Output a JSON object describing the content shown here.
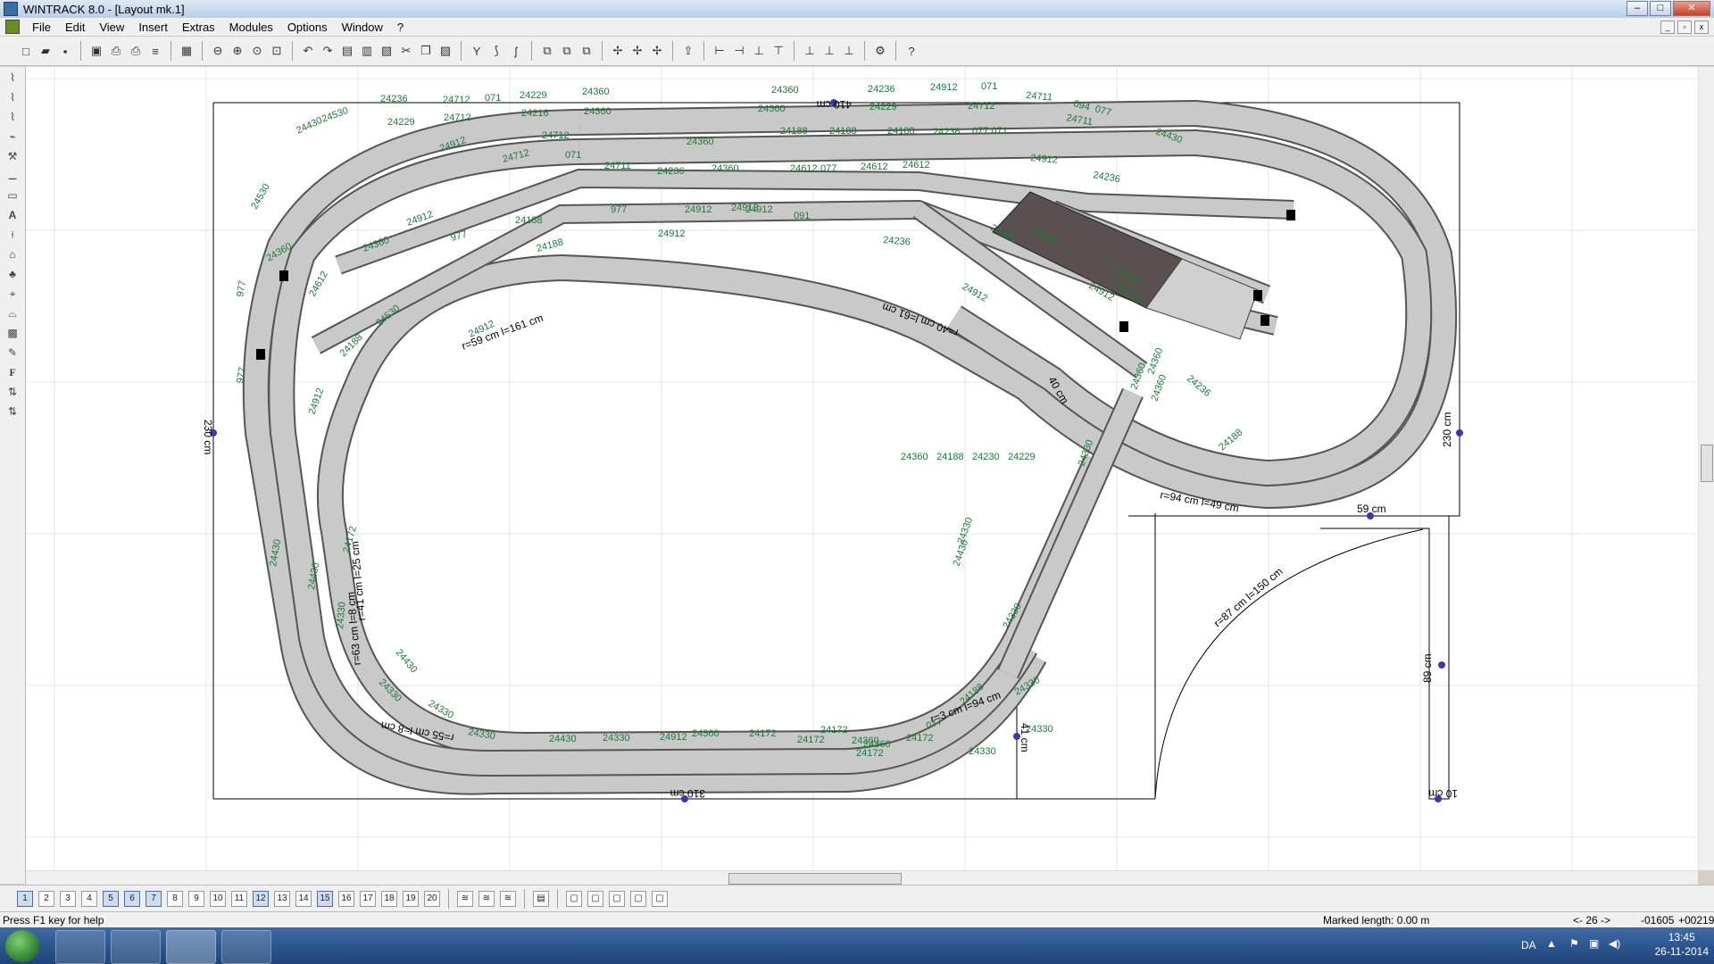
{
  "window": {
    "title": "WINTRACK 8.0 - [Layout mk.1]"
  },
  "menu": [
    "File",
    "Edit",
    "View",
    "Insert",
    "Extras",
    "Modules",
    "Options",
    "Window",
    "?"
  ],
  "toolbar_icons": [
    "new-icon",
    "open-icon",
    "save-icon",
    "preview-icon",
    "print-icon",
    "print-setup-icon",
    "list-icon",
    "image-icon",
    "zoom-out-icon",
    "zoom-in-icon",
    "zoom-window-icon",
    "zoom-all-icon",
    "undo-icon",
    "redo-icon",
    "cut-icon",
    "copy-icon",
    "paste-icon",
    "track-icon",
    "curve-icon",
    "flex-icon",
    "help-icon"
  ],
  "left_tools": [
    "flex-icon",
    "flex2-icon",
    "flex3-icon",
    "tool-icon",
    "ruler-icon",
    "level-icon",
    "text-icon",
    "arrow-icon",
    "house-icon",
    "tree-icon",
    "cross-icon",
    "bridge-icon",
    "chart-icon",
    "pencil-icon",
    "font-icon",
    "spacer-icon",
    "spacer2-icon"
  ],
  "layers": [
    "1",
    "2",
    "3",
    "4",
    "5",
    "6",
    "7",
    "8",
    "9",
    "10",
    "11",
    "12",
    "13",
    "14",
    "15",
    "16",
    "17",
    "18",
    "19",
    "20"
  ],
  "status": {
    "help": "Press F1 key for help",
    "marked": "Marked length: 0.00 m",
    "page": "<- 26 ->",
    "x": "-01605",
    "y": "+00219"
  },
  "taskbar": {
    "lang": "DA",
    "time": "13:45",
    "date": "26-11-2014"
  },
  "drawing": {
    "dimensions": [
      "410 cm",
      "310 cm",
      "230 cm",
      "230 cm",
      "59 cm",
      "89 cm",
      "10 cm",
      "41 cm",
      "40 cm"
    ],
    "radii": [
      "r=94 cm l=49 cm",
      "r=87 cm l=150 cm",
      "r=59 cm l=161 cm",
      "r=55 cm l=8 cm",
      "r=41 cm l=25 cm",
      "r=63 cm l=8 cm",
      "r=3 cm l=94 cm",
      "r=40 cm l=61 cm"
    ],
    "track_labels": [
      {
        "t": "24530"
      },
      {
        "t": "24236"
      },
      {
        "t": "24712"
      },
      {
        "t": "071"
      },
      {
        "t": "24229"
      },
      {
        "t": "24360"
      },
      {
        "t": "24360"
      },
      {
        "t": "24236"
      },
      {
        "t": "24912"
      },
      {
        "t": "071"
      },
      {
        "t": "24711"
      },
      {
        "t": "094"
      },
      {
        "t": "077"
      },
      {
        "t": "24430"
      },
      {
        "t": "24430"
      },
      {
        "t": "24229"
      },
      {
        "t": "24712"
      },
      {
        "t": "24216"
      },
      {
        "t": "24360"
      },
      {
        "t": "24360"
      },
      {
        "t": "24229"
      },
      {
        "t": "24712"
      },
      {
        "t": "24711"
      },
      {
        "t": "24912"
      },
      {
        "t": "24712"
      },
      {
        "t": "24360"
      },
      {
        "t": "24188"
      },
      {
        "t": "24188"
      },
      {
        "t": "24188"
      },
      {
        "t": "24236"
      },
      {
        "t": "077 071"
      },
      {
        "t": "24912"
      },
      {
        "t": "24236"
      },
      {
        "t": "24530"
      },
      {
        "t": "24712"
      },
      {
        "t": "071"
      },
      {
        "t": "24711"
      },
      {
        "t": "24236"
      },
      {
        "t": "24360"
      },
      {
        "t": "24612"
      },
      {
        "t": "077"
      },
      {
        "t": "24612"
      },
      {
        "t": "24612"
      },
      {
        "t": "24912"
      },
      {
        "t": "24188"
      },
      {
        "t": "977"
      },
      {
        "t": "24912"
      },
      {
        "t": "24912"
      },
      {
        "t": "24912"
      },
      {
        "t": "091"
      },
      {
        "t": "24236"
      },
      {
        "t": "24360"
      },
      {
        "t": "24360"
      },
      {
        "t": "24360"
      },
      {
        "t": "24360"
      },
      {
        "t": "977"
      },
      {
        "t": "24188"
      },
      {
        "t": "24912"
      },
      {
        "t": "24912"
      },
      {
        "t": "24912"
      },
      {
        "t": "24530"
      },
      {
        "t": "24236"
      },
      {
        "t": "977"
      },
      {
        "t": "977"
      },
      {
        "t": "24612"
      },
      {
        "t": "24530"
      },
      {
        "t": "24188"
      },
      {
        "t": "24912"
      },
      {
        "t": "24912"
      },
      {
        "t": "24236"
      },
      {
        "t": "24188"
      },
      {
        "t": "24430"
      },
      {
        "t": "24430"
      },
      {
        "t": "24172"
      },
      {
        "t": "24330"
      },
      {
        "t": "24430"
      },
      {
        "t": "24330"
      },
      {
        "t": "24330"
      },
      {
        "t": "24330"
      },
      {
        "t": "24430"
      },
      {
        "t": "24330"
      },
      {
        "t": "24912"
      },
      {
        "t": "24360"
      },
      {
        "t": "24172"
      },
      {
        "t": "24172"
      },
      {
        "t": "24360"
      },
      {
        "t": "24360"
      },
      {
        "t": "24172"
      },
      {
        "t": "24172"
      },
      {
        "t": "24172"
      },
      {
        "t": "077"
      },
      {
        "t": "24188"
      },
      {
        "t": "24330"
      },
      {
        "t": "24330"
      },
      {
        "t": "24330"
      },
      {
        "t": "24330"
      },
      {
        "t": "24430"
      },
      {
        "t": "24330"
      },
      {
        "t": "24330"
      },
      {
        "t": "24360"
      },
      {
        "t": "24360"
      },
      {
        "t": "24360"
      },
      {
        "t": "24360"
      },
      {
        "t": "24188"
      },
      {
        "t": "24230"
      },
      {
        "t": "24229"
      }
    ]
  }
}
